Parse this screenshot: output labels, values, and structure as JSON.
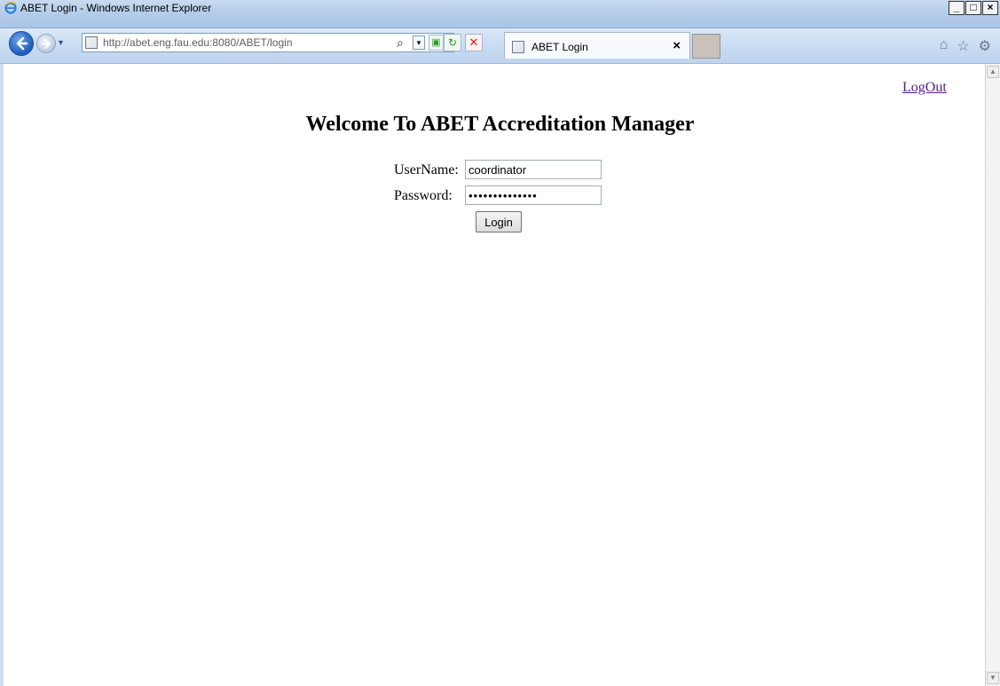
{
  "window": {
    "title": "ABET Login - Windows Internet Explorer"
  },
  "window_controls": {
    "minimize": "_",
    "maximize": "□",
    "close": "×"
  },
  "nav": {
    "url": "http://abet.eng.fau.edu:8080/ABET/login",
    "search_glyph": "⌕",
    "dropdown_glyph": "▾"
  },
  "tab": {
    "title": "ABET Login",
    "close": "×"
  },
  "page": {
    "logout_link": "LogOut",
    "heading": "Welcome To ABET Accreditation Manager",
    "username_label": "UserName:",
    "username_value": "coordinator",
    "password_label": "Password:",
    "password_value": "••••••••••••••",
    "login_button": "Login"
  },
  "colors": {
    "link": "#551a8b",
    "titlebar": "#b4cdea",
    "navbar": "#c6daf2"
  },
  "icons": [
    "ie-logo-icon",
    "back-arrow-icon",
    "forward-arrow-icon",
    "page-icon",
    "search-icon",
    "compatibility-icon",
    "refresh-icon",
    "stop-icon",
    "home-icon",
    "favorites-icon",
    "tools-gear-icon"
  ]
}
